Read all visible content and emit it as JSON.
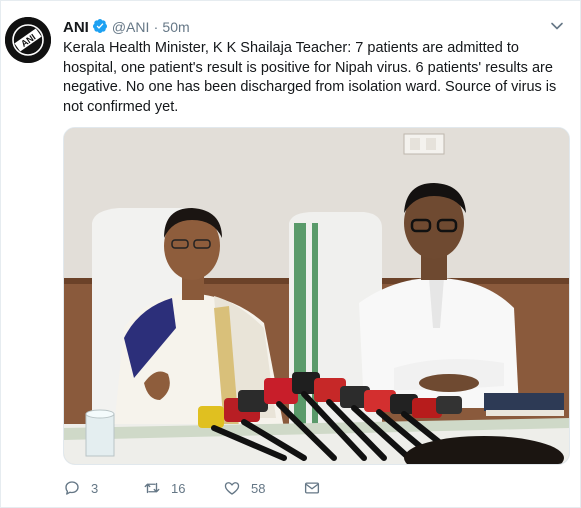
{
  "tweet": {
    "author": {
      "name": "ANI",
      "handle": "@ANI",
      "separator": "·",
      "time": "50m",
      "avatar_text": "ANI"
    },
    "text": "Kerala Health Minister, K K Shailaja Teacher: 7 patients are admitted to hospital, one patient's result is positive for Nipah virus. 6 patients' results are negative. No one has been discharged from isolation ward. Source of virus is not confirmed yet.",
    "actions": {
      "replies": "3",
      "retweets": "16",
      "likes": "58"
    },
    "icons": {
      "verified": "verified-badge-icon",
      "menu": "chevron-down-icon",
      "reply": "reply-icon",
      "retweet": "retweet-icon",
      "like": "heart-icon",
      "message": "envelope-icon"
    },
    "colors": {
      "verified": "#1da1f2",
      "icon_gray": "#657786",
      "name": "#14171a"
    }
  }
}
